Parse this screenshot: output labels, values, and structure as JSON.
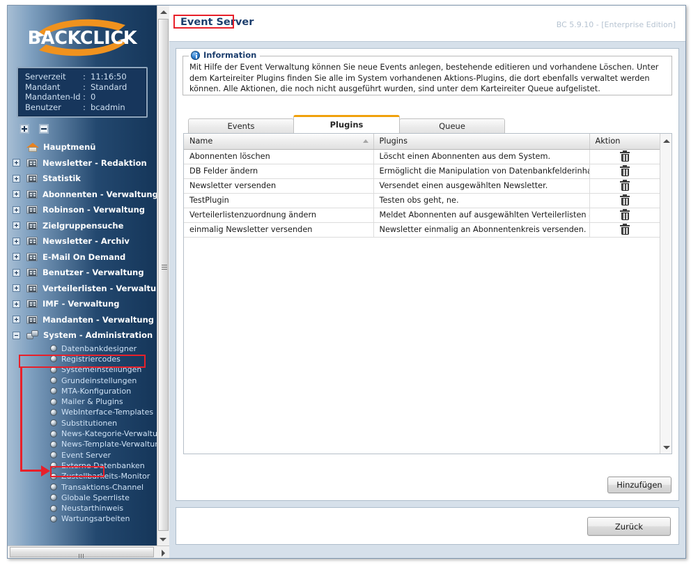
{
  "window": {
    "version_label": "BC 5.9.10 - [Enterprise Edition]",
    "page_title": "Event Server"
  },
  "sidebar": {
    "logo_text": "BACKCLICK",
    "status": {
      "rows": [
        {
          "key": "Serverzeit",
          "sep": ":",
          "value": "11:16:50"
        },
        {
          "key": "Mandant",
          "sep": ":",
          "value": "Standard"
        },
        {
          "key": "Mandanten-Id",
          "sep": ":",
          "value": "0"
        },
        {
          "key": "Benutzer",
          "sep": ":",
          "value": "bcadmin"
        }
      ]
    },
    "controls": {
      "expand_all": "expand-all-icon",
      "collapse_all": "collapse-all-icon"
    },
    "tree": [
      {
        "label": "Hauptmenü",
        "icon": "house-icon",
        "expander": "none"
      },
      {
        "label": "Newsletter - Redaktion",
        "icon": "folder-icon",
        "expander": "plus"
      },
      {
        "label": "Statistik",
        "icon": "folder-icon",
        "expander": "plus"
      },
      {
        "label": "Abonnenten - Verwaltung",
        "icon": "folder-icon",
        "expander": "plus"
      },
      {
        "label": "Robinson - Verwaltung",
        "icon": "folder-icon",
        "expander": "plus"
      },
      {
        "label": "Zielgruppensuche",
        "icon": "folder-icon",
        "expander": "plus"
      },
      {
        "label": "Newsletter - Archiv",
        "icon": "folder-icon",
        "expander": "plus"
      },
      {
        "label": "E-Mail On Demand",
        "icon": "folder-icon",
        "expander": "plus"
      },
      {
        "label": "Benutzer - Verwaltung",
        "icon": "folder-icon",
        "expander": "plus"
      },
      {
        "label": "Verteilerlisten - Verwaltung",
        "icon": "folder-icon",
        "expander": "plus"
      },
      {
        "label": "IMF - Verwaltung",
        "icon": "folder-icon",
        "expander": "plus"
      },
      {
        "label": "Mandanten - Verwaltung",
        "icon": "folder-icon",
        "expander": "plus"
      },
      {
        "label": "System - Administration",
        "icon": "gears-icon",
        "expander": "minus"
      }
    ],
    "subitems": [
      {
        "label": "Datenbankdesigner"
      },
      {
        "label": "Registriercodes"
      },
      {
        "label": "Systemeinstellungen"
      },
      {
        "label": "Grundeinstellungen"
      },
      {
        "label": "MTA-Konfiguration"
      },
      {
        "label": "Mailer & Plugins"
      },
      {
        "label": "WebInterface-Templates"
      },
      {
        "label": "Substitutionen"
      },
      {
        "label": "News-Kategorie-Verwaltung"
      },
      {
        "label": "News-Template-Verwaltung"
      },
      {
        "label": "Event Server"
      },
      {
        "label": "Externe Datenbanken"
      },
      {
        "label": "Zustellbarkeits-Monitor"
      },
      {
        "label": "Transaktions-Channel"
      },
      {
        "label": "Globale Sperrliste"
      },
      {
        "label": "Neustarthinweis"
      },
      {
        "label": "Wartungsarbeiten"
      }
    ]
  },
  "information": {
    "legend": "Information",
    "text": "Mit Hilfe der Event Verwaltung können Sie neue Events anlegen, bestehende editieren und vorhandene Löschen. Unter dem Karteireiter Plugins finden Sie alle im System vorhandenen Aktions-Plugins, die dort ebenfalls verwaltet werden können. Alle Aktionen, die noch nicht ausgeführt wurden, sind unter dem Karteireiter Queue aufgelistet."
  },
  "tabs": [
    {
      "label": "Events",
      "active": false
    },
    {
      "label": "Plugins",
      "active": true
    },
    {
      "label": "Queue",
      "active": false
    }
  ],
  "table": {
    "columns": [
      "Name",
      "Plugins",
      "Aktion"
    ],
    "sort_column": "Name",
    "sort_direction": "asc",
    "rows": [
      {
        "name": "Abonnenten löschen",
        "plugins": "Löscht einen Abonnenten aus dem System.",
        "action": "delete-icon"
      },
      {
        "name": "DB Felder ändern",
        "plugins": "Ermöglicht die Manipulation von Datenbankfelderinhalten.",
        "action": "delete-icon"
      },
      {
        "name": "Newsletter versenden",
        "plugins": "Versendet einen ausgewählten Newsletter.",
        "action": "delete-icon"
      },
      {
        "name": "TestPlugin",
        "plugins": "Testen obs geht, ne.",
        "action": "delete-icon"
      },
      {
        "name": "Verteilerlistenzuordnung ändern",
        "plugins": "Meldet Abonnenten auf ausgewählten Verteilerlisten an bzw. ab",
        "action": "delete-icon"
      },
      {
        "name": "einmalig Newsletter versenden",
        "plugins": "Newsletter einmalig an Abonnentenkreis versenden.",
        "action": "delete-icon"
      }
    ]
  },
  "buttons": {
    "add": "Hinzufügen",
    "back": "Zurück"
  },
  "annotations": {
    "highlight_title": "Event Server",
    "highlight_menu": "System - Administration",
    "highlight_submenu": "Event Server",
    "color": "#e8202a"
  }
}
